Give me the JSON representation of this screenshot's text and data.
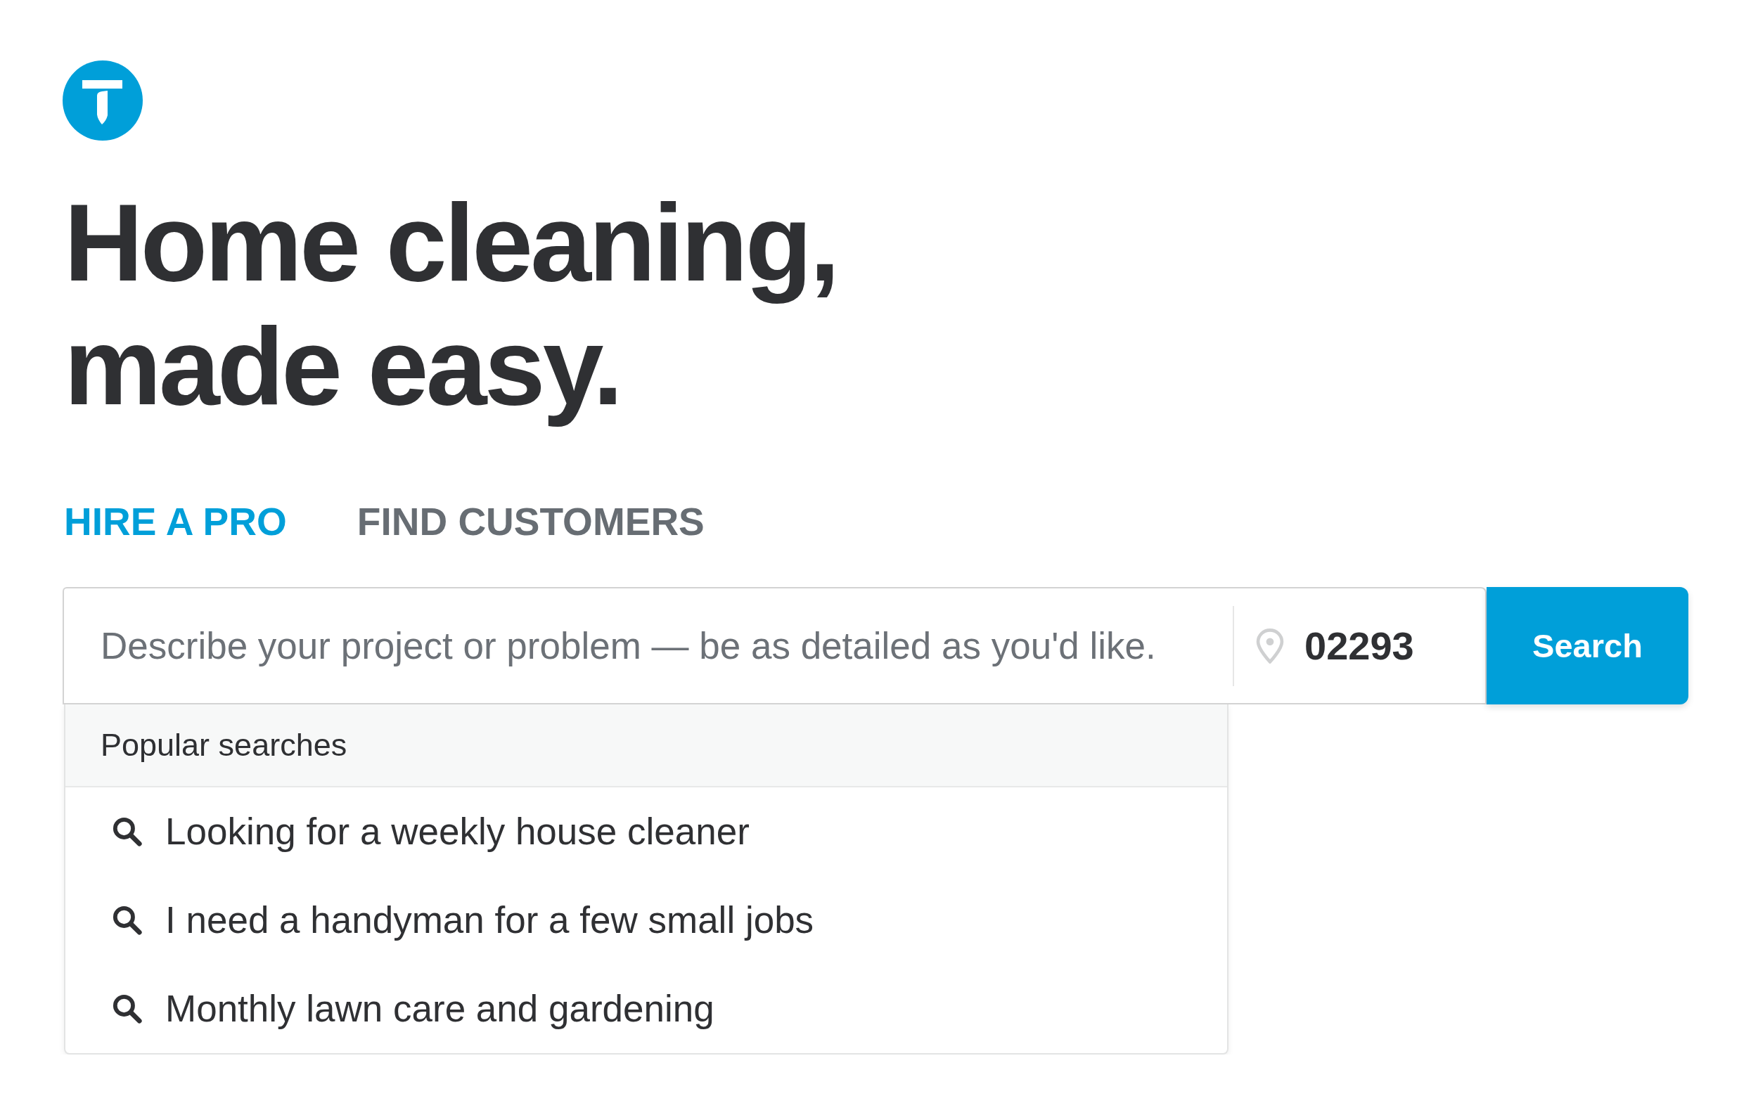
{
  "hero": {
    "title": "Home cleaning, made easy."
  },
  "tabs": [
    {
      "label": "HIRE A PRO",
      "selected": true
    },
    {
      "label": "FIND CUSTOMERS",
      "selected": false
    }
  ],
  "search": {
    "project_field": {
      "placeholder": "Describe your project or problem — be as detailed as you'd like."
    },
    "location_field": {
      "value": "02293"
    },
    "button": "Search"
  },
  "popular_searches": {
    "title": "Popular searches",
    "items": [
      "Looking for a weekly house cleaner",
      "I need a handyman for a few small jobs",
      "Monthly lawn care and gardening"
    ]
  }
}
